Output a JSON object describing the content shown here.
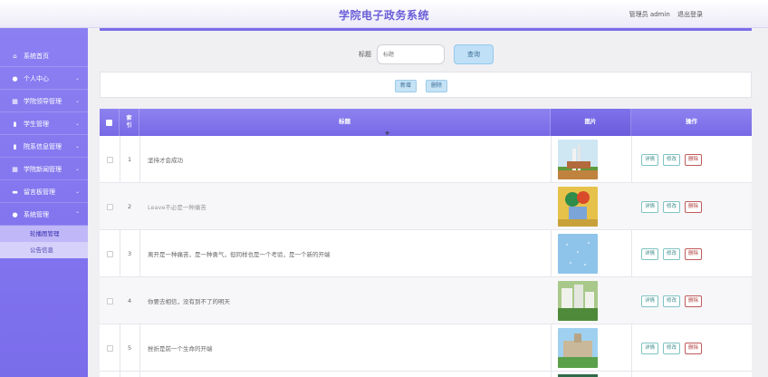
{
  "header": {
    "title": "学院电子政务系统",
    "user_label": "管理员 admin",
    "logout_label": "退出登录"
  },
  "sidebar": {
    "items": [
      {
        "label": "系统首页",
        "icon": "home-icon"
      },
      {
        "label": "个人中心",
        "icon": "user-icon"
      },
      {
        "label": "学院领导管理",
        "icon": "grid-icon"
      },
      {
        "label": "学生管理",
        "icon": "file-icon"
      },
      {
        "label": "院系信息管理",
        "icon": "file-icon"
      },
      {
        "label": "学院新闻管理",
        "icon": "grid-icon"
      },
      {
        "label": "留言板管理",
        "icon": "message-icon"
      },
      {
        "label": "系统管理",
        "icon": "user-icon"
      }
    ],
    "subitems": [
      {
        "label": "轮播图管理",
        "active": true
      },
      {
        "label": "公告信息",
        "active": false
      }
    ]
  },
  "search": {
    "label": "标题",
    "placeholder": "标题",
    "button": "查询"
  },
  "toolbar": {
    "add": "新增",
    "delete": "删除"
  },
  "table": {
    "headers": {
      "index": "索引",
      "title": "标题",
      "image": "图片",
      "actions": "操作"
    },
    "rows": [
      {
        "index": "1",
        "title": "坚持才会成功"
      },
      {
        "index": "2",
        "title": "Leave不必是一种痛苦"
      },
      {
        "index": "3",
        "title": "离开是一种痛苦，是一种勇气，但同样也是一个考验，是一个新的开端"
      },
      {
        "index": "4",
        "title": "你要去相信，没有到不了的明天"
      },
      {
        "index": "5",
        "title": "挫折是前一个生命的开端"
      }
    ],
    "actions": {
      "detail": "详情",
      "edit": "修改",
      "delete": "删除"
    }
  },
  "colors": {
    "accent": "#7b6ce8",
    "header_title": "#6b5ed8",
    "button_blue": "#c6e3f6",
    "delete_red": "#b03e3e"
  }
}
